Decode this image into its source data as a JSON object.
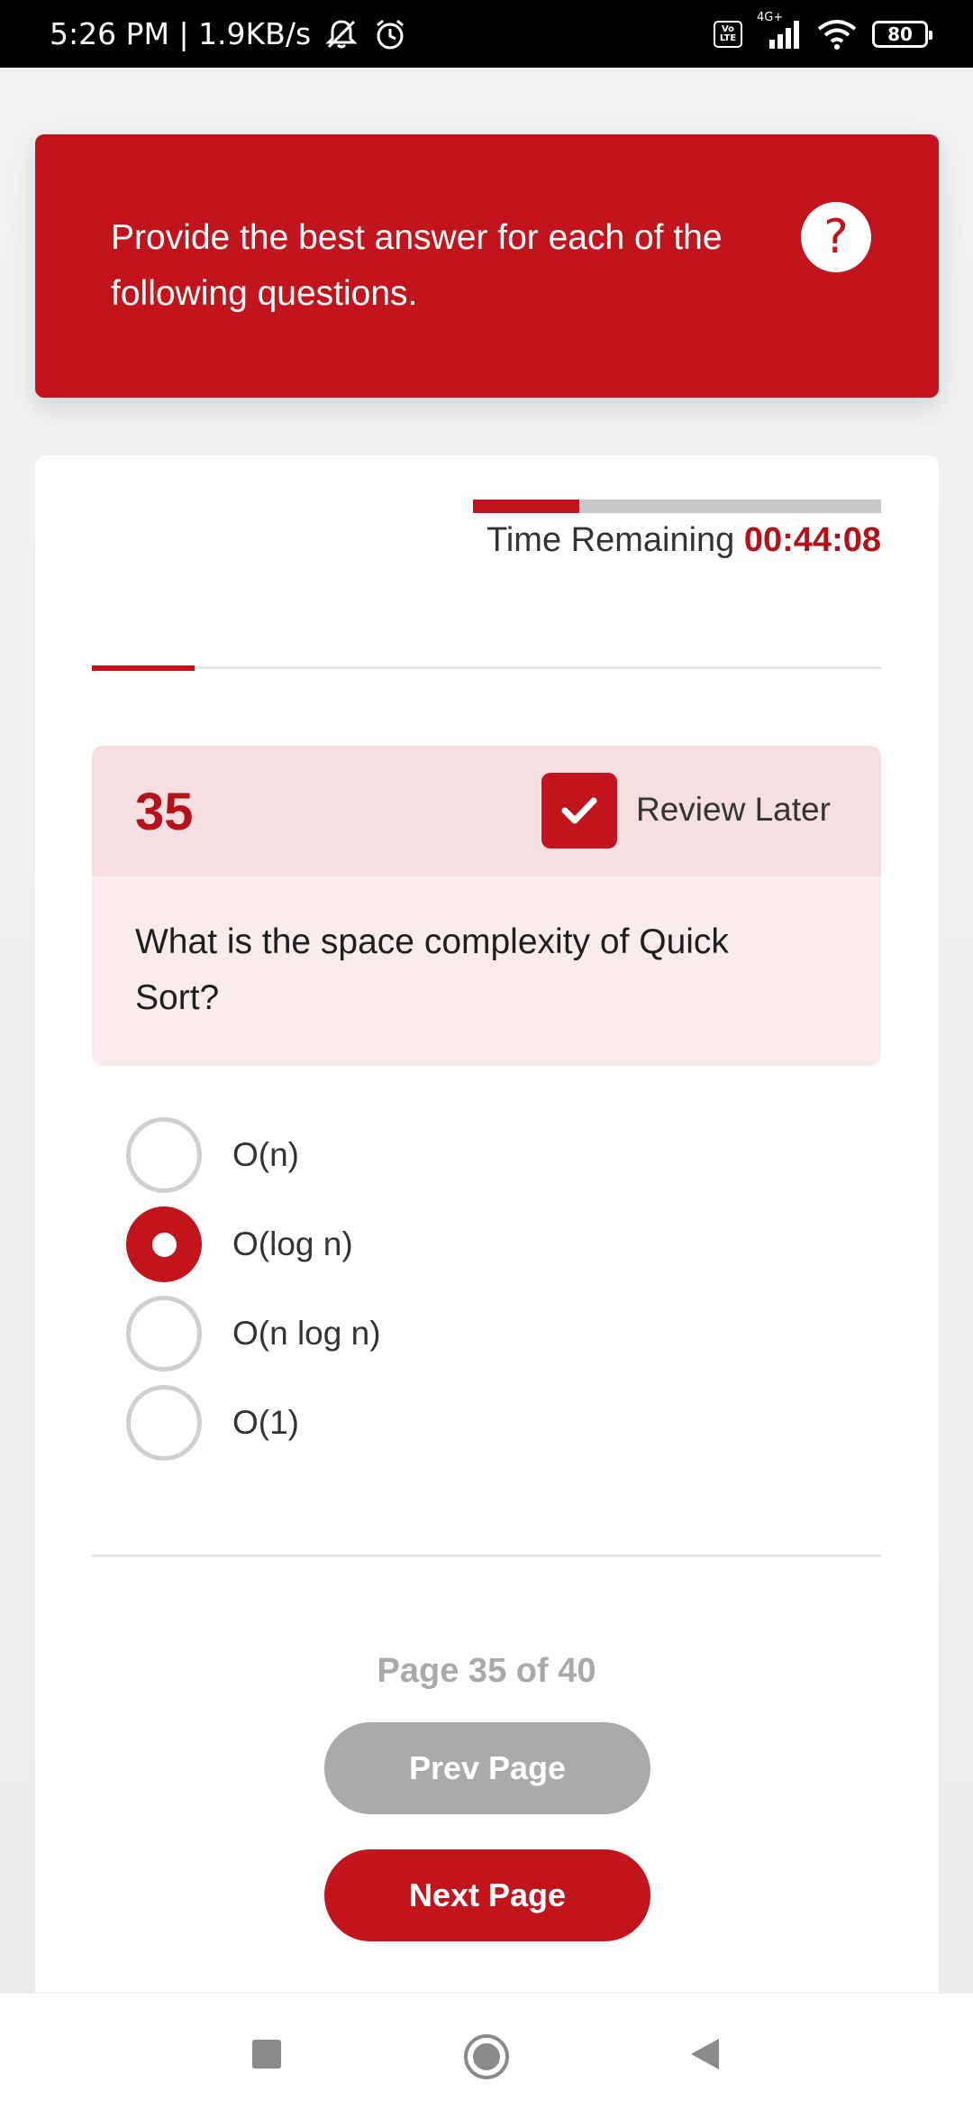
{
  "status_bar": {
    "time_and_speed": "5:26 PM | 1.9KB/s",
    "network_type": "4G+",
    "volte_top": "Vo",
    "volte_bottom": "LTE",
    "battery_level": "80"
  },
  "banner": {
    "instruction": "Provide the best answer for each of the following questions.",
    "help_symbol": "?"
  },
  "timer": {
    "label": "Time Remaining",
    "value": "00:44:08",
    "fill_fraction": 0.26
  },
  "question_progress_fraction": 0.13,
  "question": {
    "number": "35",
    "review_label": "Review Later",
    "review_checked": true,
    "text": "What is the space complexity of Quick Sort?"
  },
  "options": [
    {
      "label": "O(n)",
      "selected": false
    },
    {
      "label": "O(log n)",
      "selected": true
    },
    {
      "label": "O(n log n)",
      "selected": false
    },
    {
      "label": "O(1)",
      "selected": false
    }
  ],
  "pagination": {
    "page_info": "Page 35 of 40",
    "prev_label": "Prev Page",
    "next_label": "Next Page"
  },
  "colors": {
    "accent": "#c2141c",
    "disabled": "#aaaaaa"
  }
}
